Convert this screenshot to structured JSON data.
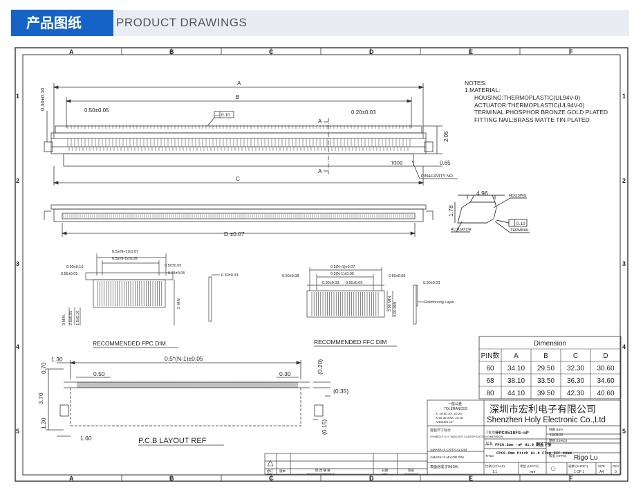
{
  "header": {
    "cn_title": "产品图纸",
    "en_title": "PRODUCT DRAWINGS"
  },
  "zones": {
    "columns": [
      "A",
      "B",
      "C",
      "D",
      "E",
      "F"
    ],
    "rows": [
      "1",
      "2",
      "3",
      "4",
      "5"
    ]
  },
  "notes": {
    "heading": "NOTES:",
    "lines": [
      "1.MATERIAL:",
      "HOUSING:THERMOPLASTIC(UL94V-0)",
      "ACTUATOR:THERMOPLASTIC(UL94V-0)",
      "TERMINAL:PHOSPHOR BRONZE GOLD PLATED",
      "FITTING NAIL:BRASS MATTE TIN PLATED"
    ]
  },
  "top_view": {
    "dim_a": "A",
    "dim_b": "B",
    "dim_c": "C",
    "pitch": "0.50±0.05",
    "width_tol": "0.20±0.03",
    "offset": "0.30±0.10",
    "flatness_sym": "—",
    "flatness_val": "0.10",
    "height": "2.05",
    "lead": "0.65",
    "section_a": "A",
    "part_mark": "BOD1",
    "pin_label": "PIN&CAVITY NO."
  },
  "front_view": {
    "dim_d": "D ±0.07"
  },
  "side_view": {
    "width": "4.96",
    "height": "1.78",
    "housing": "HOUSING",
    "actuator": "ACTUATOR",
    "terminal": "TERMINAL",
    "flatness_val": "0.10"
  },
  "fpc": {
    "caption": "RECOMMENDED FPC DIM.",
    "dims": [
      "0.5x(N+1)±0.07",
      "0.5x(N-1)±0.05",
      "0.50±0.10",
      "0.55±0.05",
      "0.50±0.05",
      "0.35±0.05",
      "5 MIN.",
      "3 MIN.",
      "2.5±0.05",
      "1.5±0.10",
      "0.30±0.03"
    ]
  },
  "ffc": {
    "caption": "RECOMMENDED FFC DIM",
    "dims": [
      "0.5(N+1)±0.07",
      "0.5(N-1)±0.05",
      "0.50±0.08",
      "0.30±0.03",
      "0.50±0.05",
      "0.50±0.08",
      "3.00 MIN.",
      "4.00 MIN.",
      "0.30±0.03"
    ],
    "reinforcing": "Reinforcing Layer"
  },
  "pcb": {
    "caption": "P.C.B LAYOUT REF",
    "dims": [
      "1.30",
      "0.5*(N-1)±0.05",
      "0.70",
      "0.50",
      "0.30",
      "(0.20)",
      "(0.35)",
      "3.70",
      "1.30",
      "1.60",
      "(0.15)"
    ]
  },
  "dimension_table": {
    "title": "Dimension",
    "headers": [
      "PIN数",
      "A",
      "B",
      "C",
      "D"
    ],
    "rows": [
      [
        "60",
        "34.10",
        "29.50",
        "32.30",
        "30.60"
      ],
      [
        "68",
        "38.10",
        "33.50",
        "36.30",
        "34.60"
      ],
      [
        "80",
        "44.10",
        "39.50",
        "42.30",
        "40.60"
      ]
    ]
  },
  "title_block": {
    "company_cn": "深圳市宏利电子有限公司",
    "company_en": "Shenzhen Holy Electronic Co.,Ltd",
    "tol_title": "一般公差",
    "tol_en": "TOLERANCES",
    "tol_lines": [
      "X. ±0.40   XX. ±0.20",
      "X ±0.30   XXX. ±0.10",
      "ANGLES   ±2°"
    ],
    "check_title": "检验尺寸标示",
    "symbols_text": "SYMBOLS ◎ ⊙ INDICATE CLASSIFICATION DIMENSION",
    "critical": "◎MARK IS CRITICAL DIM",
    "major": "⊙MARK IS MAJOR DIM",
    "finish": "表面处理 (FINISH)",
    "part_no_label": "工程 图号",
    "part_no": "FPC0518FG-nP",
    "desc_label": "品名",
    "desc": "FPC0.5mm -nP H1.8 翻盖下接",
    "title_label": "TITLE",
    "title_text": "FPC0.5mm Pitch H1.8 Flip ZIF CONN",
    "drawn_label": "制图 (DR)",
    "drawn_date": "'10/03/22",
    "check_label": "审核 (CHKD)",
    "approve_label": "核准 (APPD)",
    "approver": "Rigo Lu",
    "scale_label": "比例 (SCALE)",
    "scale": "1:1",
    "unit_label": "单位 (UNITS)",
    "unit": "mm",
    "sheet_label": "张数 (SHEET)",
    "sheet": "1 OF 1",
    "size_label": "SIZE",
    "size": "A4",
    "rev_label": "REV",
    "rev": "0",
    "rev_rows": [
      "修订",
      "版本",
      "修 改 摘 要",
      "日期",
      "签名"
    ],
    "rev_sub": [
      "REV",
      "",
      "REVISED INFORMATION",
      "DATE",
      "SIGNATURE"
    ]
  }
}
